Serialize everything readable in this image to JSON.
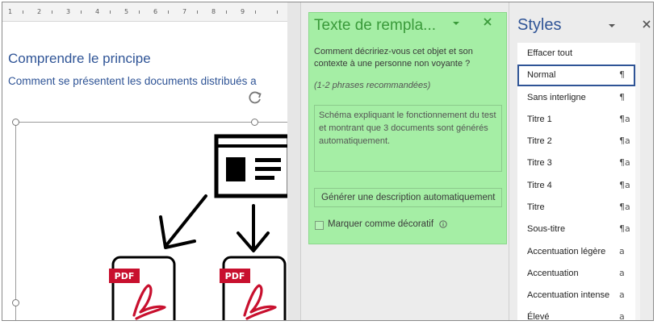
{
  "document": {
    "ruler_labels": [
      "1",
      "2",
      "3",
      "4",
      "5",
      "6",
      "7",
      "8",
      "9"
    ],
    "heading": "Comprendre le principe",
    "subheading": "Comment se présentent les documents distribués a",
    "pdf_label": "PDF"
  },
  "alt_text_pane": {
    "title": "Texte de rempla...",
    "description": "Comment décririez-vous cet objet et son contexte à une personne non voyante ?",
    "hint": "(1-2 phrases recommandées)",
    "alt_text_value": "Schéma expliquant le fonctionnement du test et montrant que  3 documents sont générés automatiquement.",
    "generate_button": "Générer une description automatiquement",
    "decorative_label": "Marquer comme décoratif",
    "panel_color": "#a5eea5"
  },
  "styles_pane": {
    "title": "Styles",
    "items": [
      {
        "label": "Effacer tout",
        "glyph": ""
      },
      {
        "label": "Normal",
        "glyph": "¶"
      },
      {
        "label": "Sans interligne",
        "glyph": "¶"
      },
      {
        "label": "Titre 1",
        "glyph": "¶a"
      },
      {
        "label": "Titre 2",
        "glyph": "¶a"
      },
      {
        "label": "Titre 3",
        "glyph": "¶a"
      },
      {
        "label": "Titre 4",
        "glyph": "¶a"
      },
      {
        "label": "Titre",
        "glyph": "¶a"
      },
      {
        "label": "Sous-titre",
        "glyph": "¶a"
      },
      {
        "label": "Accentuation légère",
        "glyph": "a"
      },
      {
        "label": "Accentuation",
        "glyph": "a"
      },
      {
        "label": "Accentuation intense",
        "glyph": "a"
      },
      {
        "label": "Élevé",
        "glyph": "a"
      }
    ],
    "selected_index": 1,
    "accent_color": "#2f5496"
  }
}
